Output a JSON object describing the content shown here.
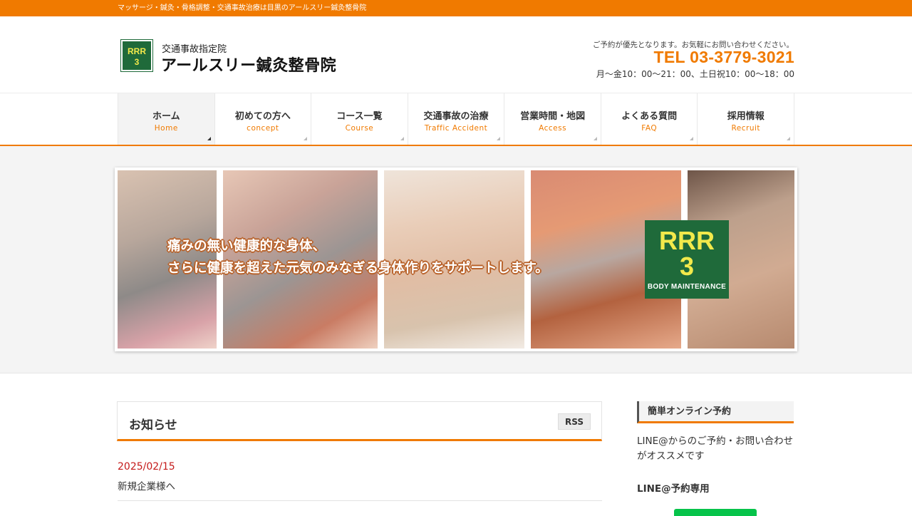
{
  "topbar": {
    "tagline": "マッサージ・鍼灸・骨格調整・交通事故治療は目黒のアールスリー鍼灸整骨院"
  },
  "header": {
    "logo_text_line1": "RRR",
    "logo_text_line2": "3",
    "subtitle": "交通事故指定院",
    "clinic_name": "アールスリー鍼灸整骨院",
    "reservation_note": "ご予約が優先となります。お気軽にお問い合わせください。",
    "tel": "TEL 03-3779-3021",
    "hours": "月〜金10：00〜21：00、土日祝10：00〜18：00"
  },
  "nav": {
    "items": [
      {
        "jp": "ホーム",
        "en": "Home"
      },
      {
        "jp": "初めての方へ",
        "en": "concept"
      },
      {
        "jp": "コース一覧",
        "en": "Course"
      },
      {
        "jp": "交通事故の治療",
        "en": "Traffic Accident"
      },
      {
        "jp": "営業時間・地図",
        "en": "Access"
      },
      {
        "jp": "よくある質問",
        "en": "FAQ"
      },
      {
        "jp": "採用情報",
        "en": "Recruit"
      }
    ]
  },
  "hero": {
    "copy_line1": "痛みの無い健康的な身体、",
    "copy_line2": "さらに健康を超えた元気のみなぎる身体作りをサポートします。",
    "badge_line1": "RRR",
    "badge_line2": "3",
    "badge_line3": "BODY MAINTENANCE"
  },
  "news": {
    "title": "お知らせ",
    "rss_label": "RSS",
    "items": [
      {
        "date": "2025/02/15",
        "text": "新規企業様へ"
      }
    ]
  },
  "sidebar": {
    "heading": "簡単オンライン予約",
    "text": "LINE@からのご予約・お問い合わせがオススメです",
    "line_heading": "LINE@予約専用"
  },
  "colors": {
    "accent": "#f07a00",
    "brand_green": "#1f6a3a",
    "date_red": "#c41a1a",
    "line_green": "#06c34a"
  }
}
